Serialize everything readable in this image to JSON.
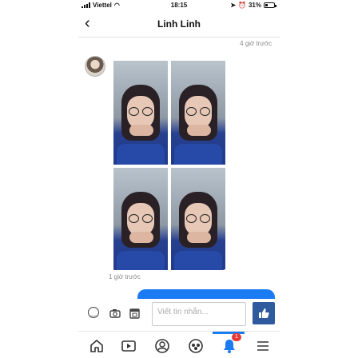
{
  "status_bar": {
    "carrier": "Viettel",
    "time": "18:15",
    "battery_percent": "31%",
    "battery_level": 0.31
  },
  "header": {
    "back_glyph": "‹",
    "title": "Linh Linh"
  },
  "messages": {
    "top_timestamp": "4 giờ trước",
    "photo_timestamp": "1 giờ trước"
  },
  "composer": {
    "placeholder": "Viết tin nhắn...",
    "icons": [
      "smile-icon",
      "camera-icon",
      "sticker-icon",
      "like-icon"
    ]
  },
  "nav": {
    "items": [
      "home-icon",
      "video-icon",
      "profile-icon",
      "groups-icon",
      "notifications-icon",
      "menu-icon"
    ],
    "notification_count": "1"
  },
  "colors": {
    "accent": "#1b7bf2",
    "like_button": "#2f5a9e",
    "badge": "#e53935"
  }
}
